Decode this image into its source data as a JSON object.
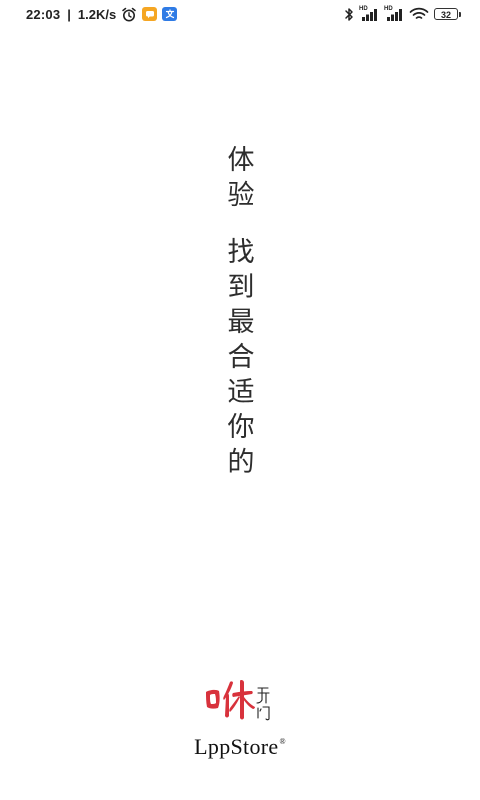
{
  "status_bar": {
    "time": "22:03",
    "separator": "|",
    "net_speed": "1.2K/s",
    "hd1": "HD",
    "hd2": "HD",
    "battery": "32",
    "icons": [
      "alarm-icon",
      "chat-app-icon",
      "translate-app-icon",
      "bluetooth-icon",
      "signal-icon",
      "signal-icon",
      "wifi-icon",
      "battery-icon"
    ],
    "colors": {
      "chat_badge": "#F5A623",
      "translate_badge": "#2F7BE5"
    }
  },
  "slogan": {
    "line1": [
      "体",
      "验"
    ],
    "line2": [
      "找",
      "到",
      "最",
      "合",
      "适",
      "你",
      "的"
    ]
  },
  "brand": {
    "logo_text_main": "咻",
    "logo_text_small": "开门",
    "name": "LppStore",
    "reg_mark": "®",
    "colors": {
      "logo_red": "#D8323C"
    }
  }
}
